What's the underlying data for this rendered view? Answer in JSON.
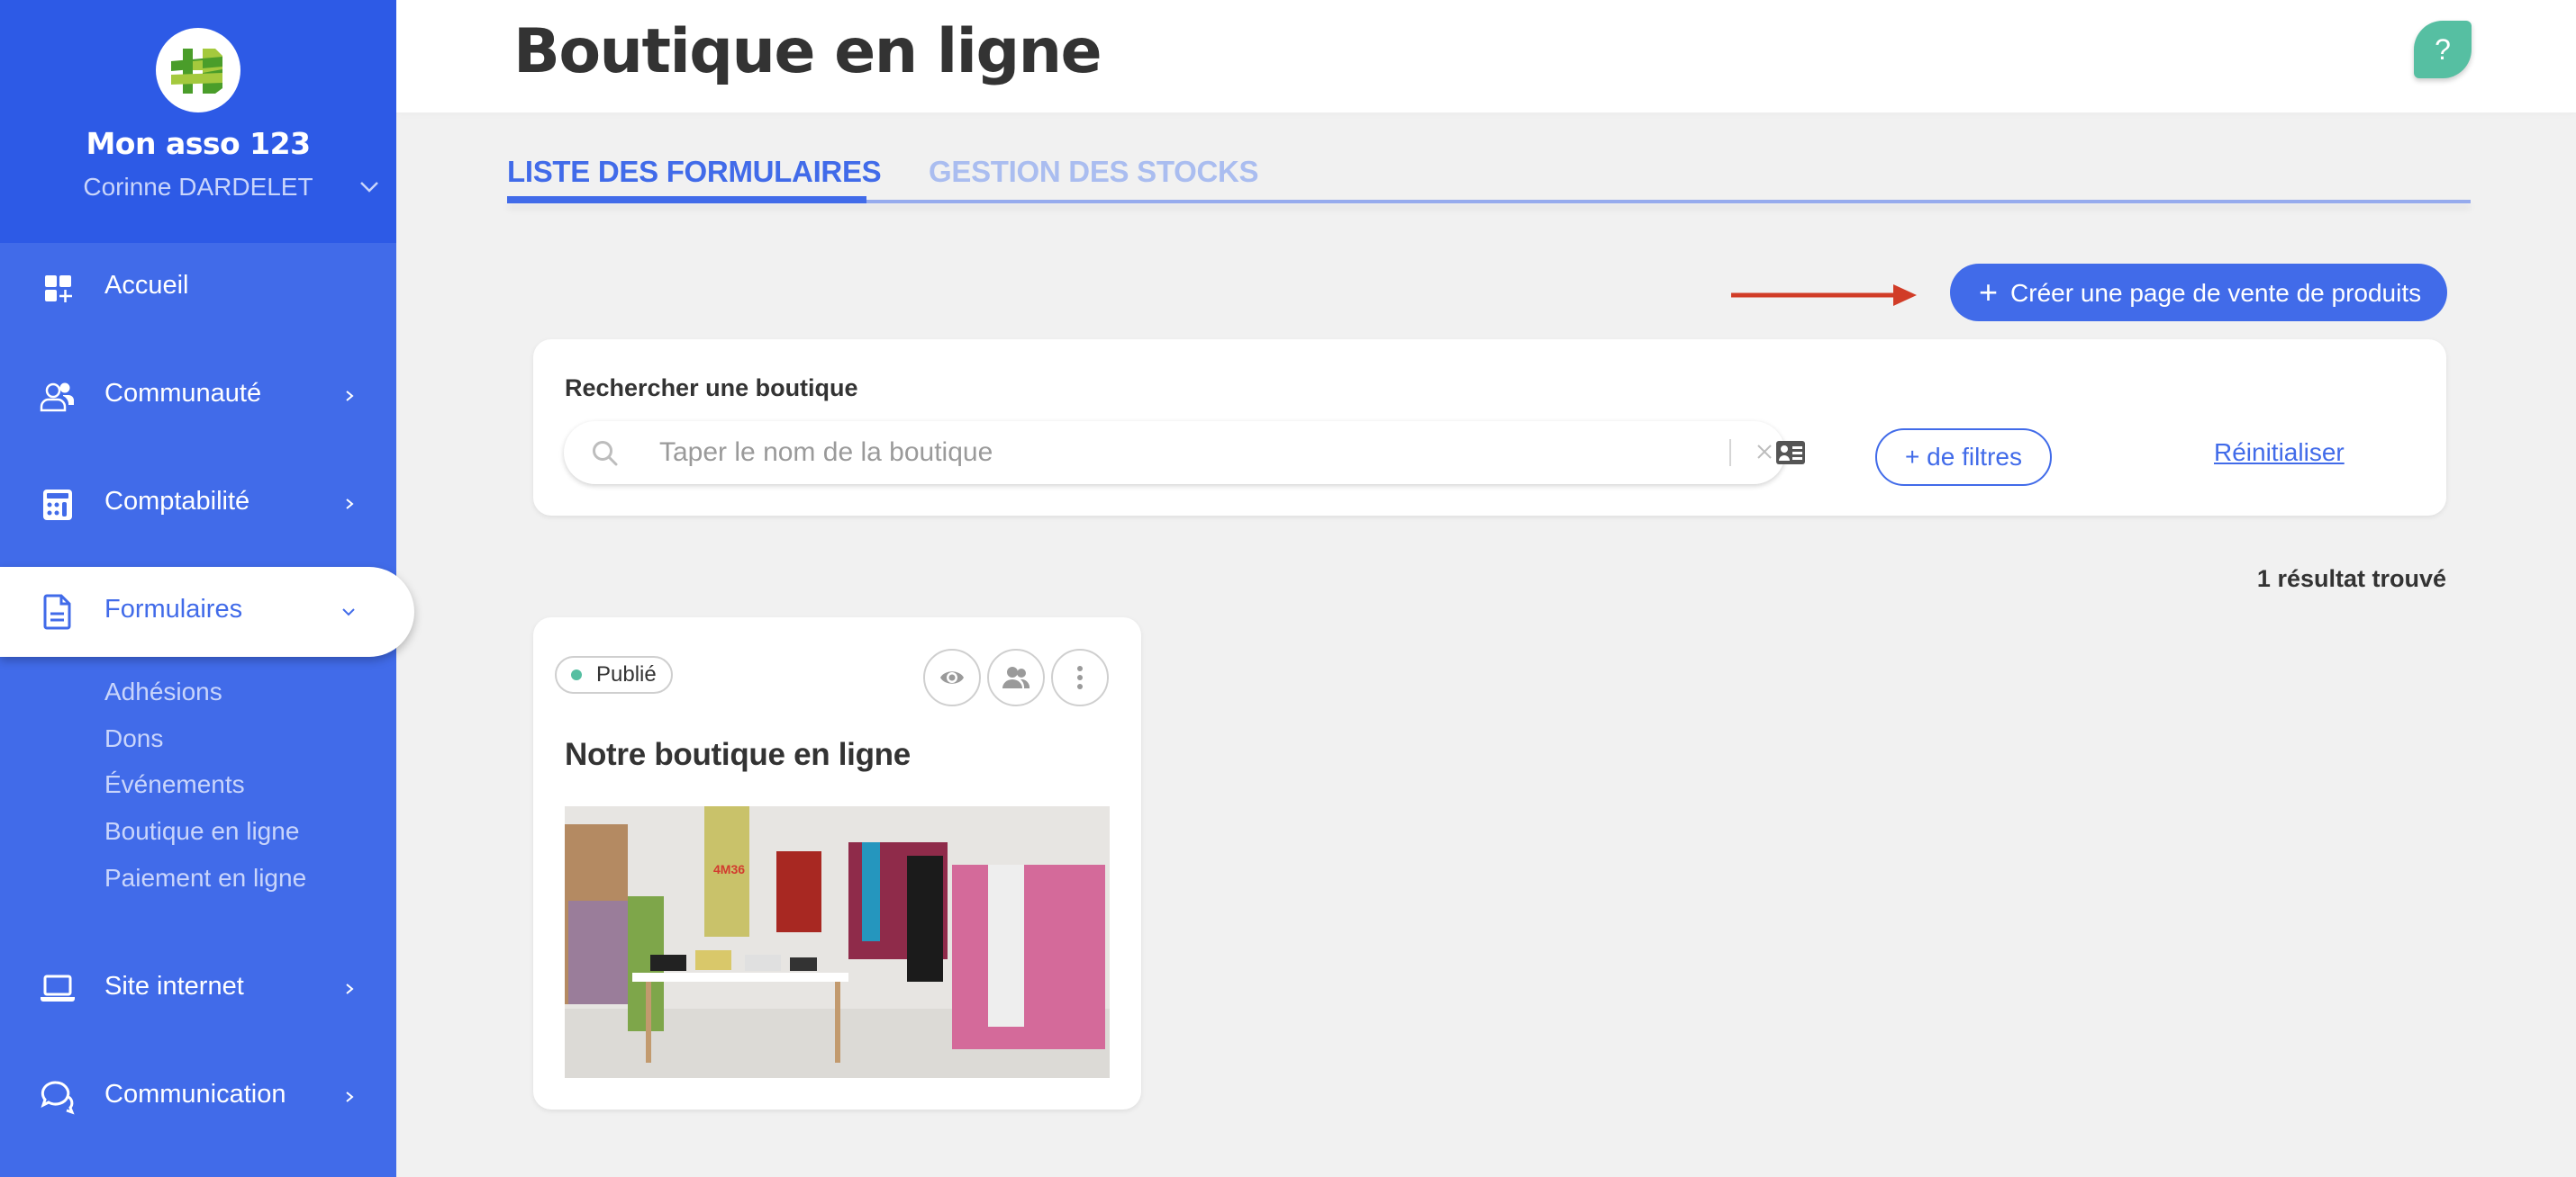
{
  "sidebar": {
    "org_name": "Mon asso 123",
    "user_name": "Corinne DARDELET",
    "items": [
      {
        "label": "Accueil",
        "icon": "dashboard-add-icon",
        "has_chevron": false
      },
      {
        "label": "Communauté",
        "icon": "users-icon",
        "has_chevron": true
      },
      {
        "label": "Comptabilité",
        "icon": "calculator-icon",
        "has_chevron": true
      },
      {
        "label": "Formulaires",
        "icon": "document-icon",
        "has_chevron": true,
        "active": true,
        "expanded": true
      },
      {
        "label": "Site internet",
        "icon": "laptop-icon",
        "has_chevron": true
      },
      {
        "label": "Communication",
        "icon": "chat-bubbles-icon",
        "has_chevron": true
      }
    ],
    "sub_items": [
      "Adhésions",
      "Dons",
      "Événements",
      "Boutique en ligne",
      "Paiement en ligne"
    ]
  },
  "header": {
    "title": "Boutique en ligne",
    "help_label": "?"
  },
  "tabs": [
    {
      "label": "LISTE DES FORMULAIRES",
      "active": true
    },
    {
      "label": "GESTION DES STOCKS",
      "active": false
    }
  ],
  "actions": {
    "create_label": "Créer une page de vente de produits",
    "create_icon": "+"
  },
  "search": {
    "label": "Rechercher une boutique",
    "placeholder": "Taper le nom de la boutique",
    "value": "",
    "filters_label": "+ de filtres",
    "reset_label": "Réinitialiser"
  },
  "results": {
    "count_text": "1 résultat trouvé"
  },
  "cards": [
    {
      "status": "Publié",
      "status_color": "#56bfa2",
      "title": "Notre boutique en ligne",
      "image_alt": "Clothing store interior",
      "poster_text": "4M36"
    }
  ],
  "colors": {
    "primary": "#416be9",
    "sidebar_top": "#2d5ae6",
    "help": "#56bfa2",
    "arrow": "#d13c27"
  }
}
